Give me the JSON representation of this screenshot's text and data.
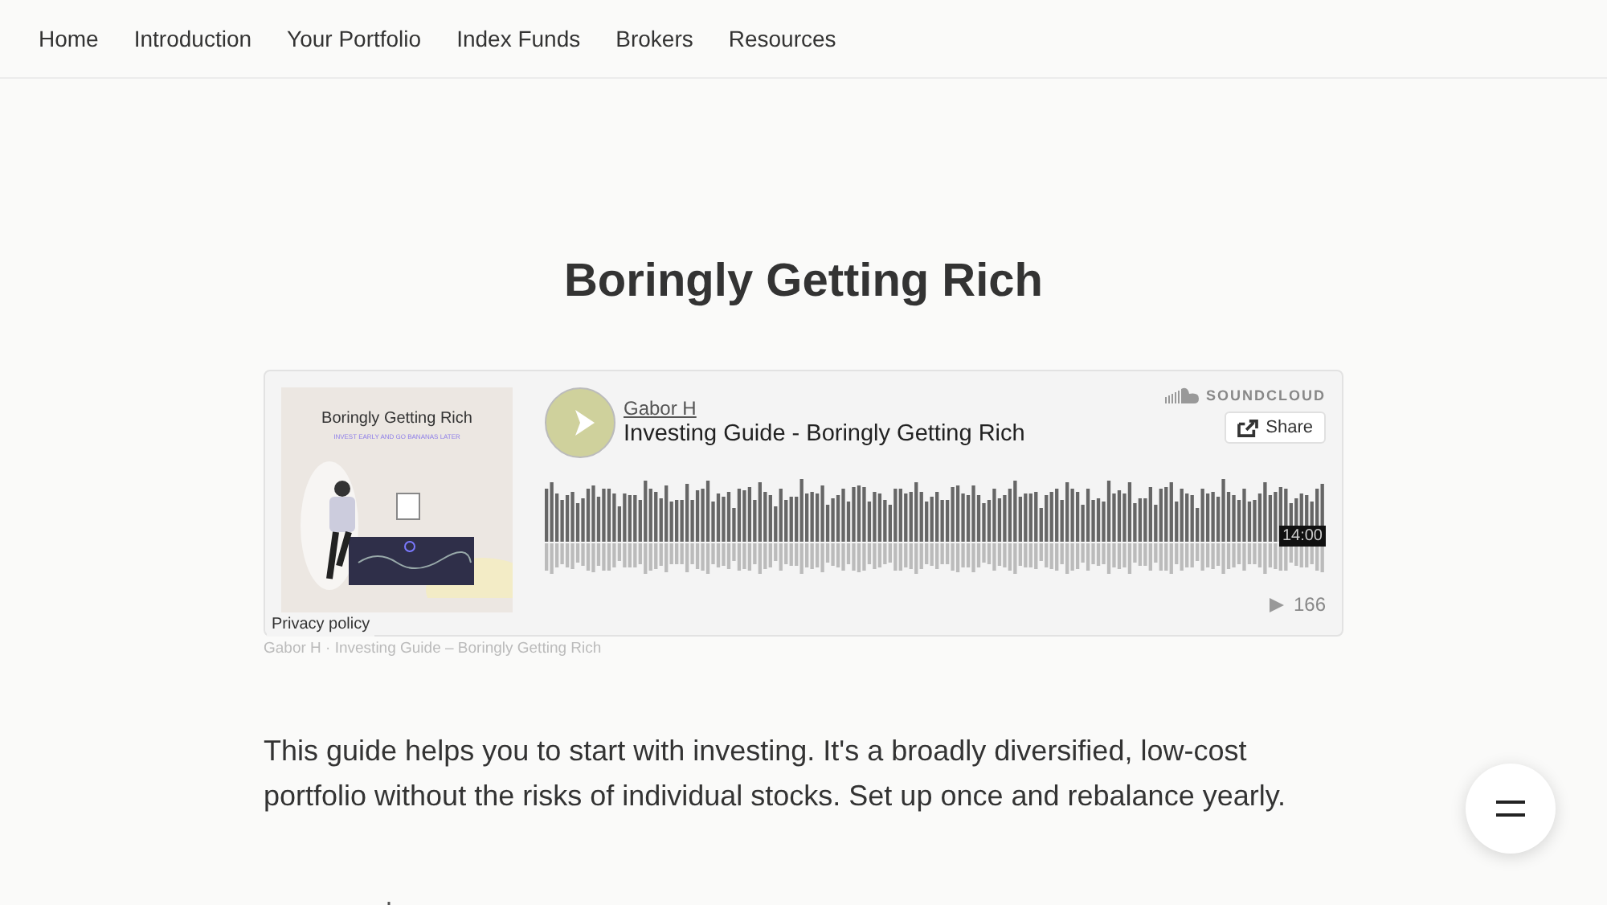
{
  "nav": {
    "items": [
      {
        "label": "Home"
      },
      {
        "label": "Introduction"
      },
      {
        "label": "Your Portfolio"
      },
      {
        "label": "Index Funds"
      },
      {
        "label": "Brokers"
      },
      {
        "label": "Resources"
      }
    ]
  },
  "title": "Boringly Getting Rich",
  "player": {
    "cover_title": "Boringly Getting Rich",
    "cover_subtitle": "INVEST EARLY AND GO BANANAS LATER",
    "privacy": "Privacy policy",
    "artist": "Gabor H",
    "track": "Investing Guide - Boringly Getting Rich",
    "brand": "SOUNDCLOUD",
    "share": "Share",
    "duration": "14:00",
    "plays": "166",
    "caption": "Gabor H · Investing Guide – Boringly Getting Rich"
  },
  "intro": "This guide helps you to start with investing. It's a broadly diversified, low-cost portfolio without the risks of individual stocks. Set up once and rebalance yearly."
}
